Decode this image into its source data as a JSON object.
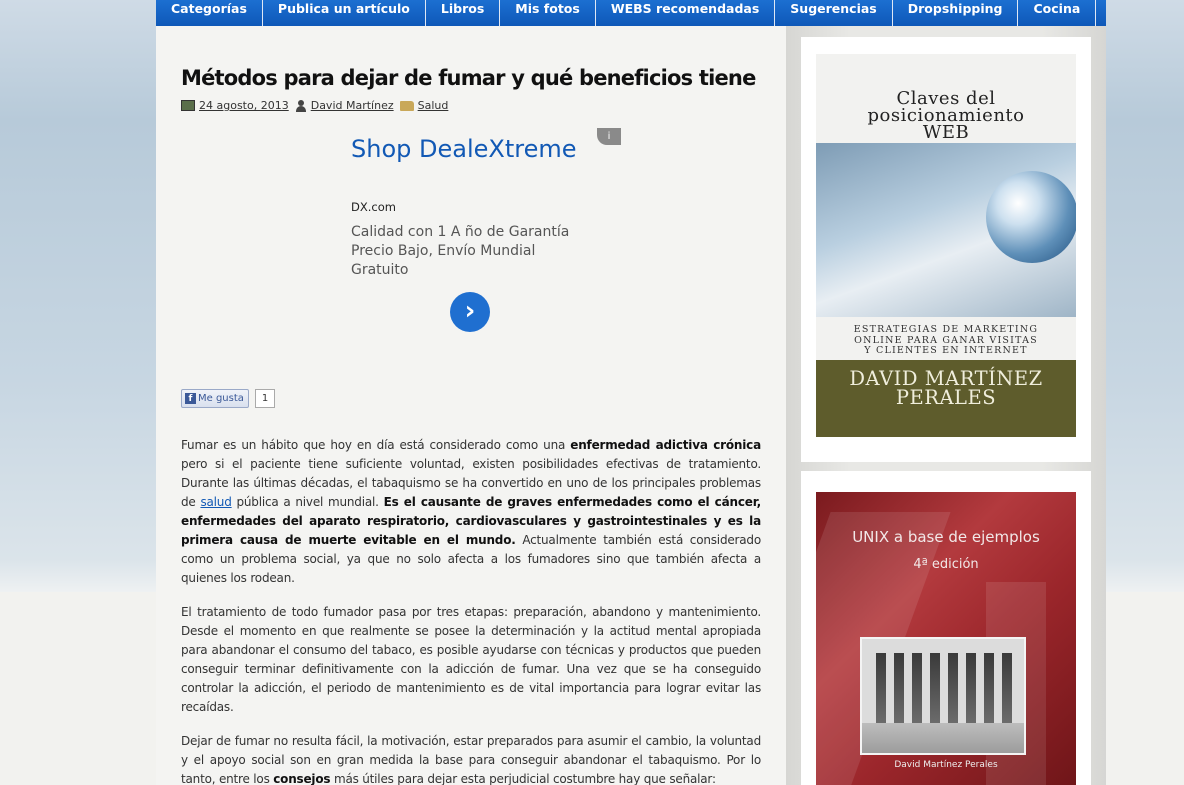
{
  "nav": {
    "items": [
      "Categorías",
      "Publica un artículo",
      "Libros",
      "Mis fotos",
      "WEBS recomendadas",
      "Sugerencias",
      "Dropshipping",
      "Cocina"
    ]
  },
  "post": {
    "title": "Métodos para dejar de fumar y qué beneficios tiene",
    "date": "24 agosto, 2013",
    "author": "David Martínez",
    "category": "Salud"
  },
  "ad": {
    "badge": "i",
    "title": "Shop DealeXtreme",
    "url": "DX.com",
    "description": "Calidad con 1 A ño de Garantía Precio Bajo, Envío Mundial Gratuito",
    "button_icon": "chevron-right-icon"
  },
  "like": {
    "label": "Me gusta",
    "count": "1"
  },
  "article": {
    "p1_a": "Fumar es un hábito que hoy en día está considerado como una ",
    "p1_b": "enfermedad adictiva crónica",
    "p1_c": " pero si el paciente tiene suficiente voluntad, existen posibilidades efectivas de tratamiento. Durante las últimas décadas, el tabaquismo se ha convertido en uno de los principales problemas de ",
    "p1_link": "salud",
    "p1_d": " pública a nivel mundial. ",
    "p1_e": "Es el causante de graves enfermedades como el cáncer, enfermedades del aparato respiratorio, cardiovasculares y gastrointestinales y es la primera causa de muerte evitable en el mundo.",
    "p1_f": " Actualmente también está considerado como un problema social, ya que no solo afecta a los fumadores sino que también afecta a quienes los rodean.",
    "p2": "El tratamiento de todo fumador pasa por tres etapas: preparación, abandono y mantenimiento. Desde el momento en que realmente se posee la determinación y la actitud mental apropiada para abandonar el consumo del tabaco, es posible ayudarse con técnicas y productos que pueden conseguir terminar definitivamente con la adicción de fumar. Una vez que se ha conseguido controlar la adicción, el periodo de mantenimiento es de vital importancia para lograr evitar las recaídas.",
    "p3_a": "Dejar de fumar no resulta fácil, la motivación, estar preparados para asumir el cambio, la voluntad y el apoyo social son en gran medida la base para conseguir abandonar el tabaquismo. Por lo tanto, entre los ",
    "p3_b": "consejos",
    "p3_c": " más útiles para dejar esta perjudicial costumbre hay que señalar:"
  },
  "sidebar": {
    "book1": {
      "title_line1": "Claves del",
      "title_line2": "posicionamiento",
      "title_line3": "WEB",
      "subtitle_line1": "ESTRATEGIAS DE MARKETING",
      "subtitle_line2": "ONLINE PARA GANAR VISITAS",
      "subtitle_line3": "Y CLIENTES EN INTERNET",
      "author_line1": "DAVID MARTÍNEZ",
      "author_line2": "PERALES"
    },
    "book2": {
      "title": "UNIX a base de ejemplos",
      "edition": "4ª edición",
      "author": "David Martínez Perales"
    }
  },
  "colors": {
    "nav": "#1464c8",
    "link": "#1259b5",
    "book1_band": "#5e5c2c",
    "book2_cover": "#9b262b"
  }
}
